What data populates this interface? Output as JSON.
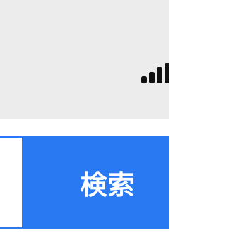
{
  "status_bar": {
    "signal_icon": "signal-strength-icon",
    "signal_color": "#111111",
    "background": "#ececec"
  },
  "search": {
    "value": "",
    "placeholder": "",
    "button_label": "検索",
    "button_color": "#2979f2"
  }
}
